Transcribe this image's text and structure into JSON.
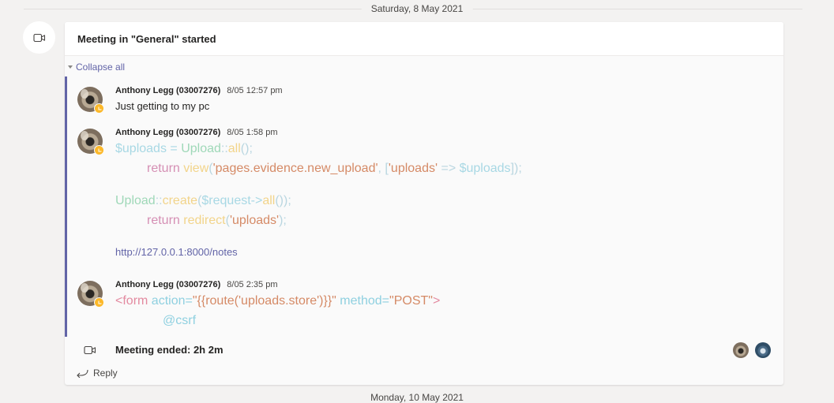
{
  "date_separator_top": "Saturday, 8 May 2021",
  "date_separator_bottom": "Monday, 10 May 2021",
  "meeting": {
    "title": "Meeting in \"General\" started",
    "collapse_label": "Collapse all",
    "ended_text": "Meeting ended: 2h 2m",
    "reply_label": "Reply"
  },
  "messages": [
    {
      "author": "Anthony Legg (03007276)",
      "time": "8/05 12:57 pm",
      "text": "Just getting to my pc"
    },
    {
      "author": "Anthony Legg (03007276)",
      "time": "8/05 1:58 pm",
      "code_lines": [
        [
          [
            "$uploads = ",
            "var"
          ],
          [
            "Upload",
            "cls"
          ],
          [
            "::",
            "punc"
          ],
          [
            "all",
            "fn"
          ],
          [
            "();",
            "punc"
          ]
        ],
        [
          [
            "return ",
            "kw"
          ],
          [
            "view",
            "fn"
          ],
          [
            "(",
            "punc"
          ],
          [
            "'pages.evidence.new_upload'",
            "str"
          ],
          [
            ", [",
            "punc"
          ],
          [
            "'uploads'",
            "str"
          ],
          [
            " => ",
            "punc"
          ],
          [
            "$uploads",
            "var"
          ],
          [
            "]);",
            "punc"
          ]
        ],
        [
          [
            "Upload",
            "cls"
          ],
          [
            "::",
            "punc"
          ],
          [
            "create",
            "fn"
          ],
          [
            "(",
            "punc"
          ],
          [
            "$request->",
            "var"
          ],
          [
            "all",
            "fn"
          ],
          [
            "());",
            "punc"
          ]
        ],
        [
          [
            "return ",
            "kw"
          ],
          [
            "redirect",
            "fn"
          ],
          [
            "(",
            "punc"
          ],
          [
            "'uploads'",
            "str"
          ],
          [
            ");",
            "punc"
          ]
        ]
      ],
      "link": "http://127.0.0.1:8000/notes"
    },
    {
      "author": "Anthony Legg (03007276)",
      "time": "8/05 2:35 pm",
      "code_lines": [
        [
          [
            "<form",
            "tag"
          ],
          [
            " action=",
            "attr"
          ],
          [
            "\"{{route('uploads.store')}}\"",
            "str"
          ],
          [
            " method=",
            "attr"
          ],
          [
            "\"POST\"",
            "str"
          ],
          [
            ">",
            "tag"
          ]
        ],
        [
          [
            "@csrf",
            "attr"
          ]
        ]
      ]
    }
  ],
  "icons": {
    "meeting": "video-camera-icon",
    "ended": "video-camera-icon",
    "reply": "reply-arrow-icon",
    "status": "away-clock-icon"
  },
  "colors": {
    "accent": "#6264a7",
    "status_away": "#fcb829"
  }
}
